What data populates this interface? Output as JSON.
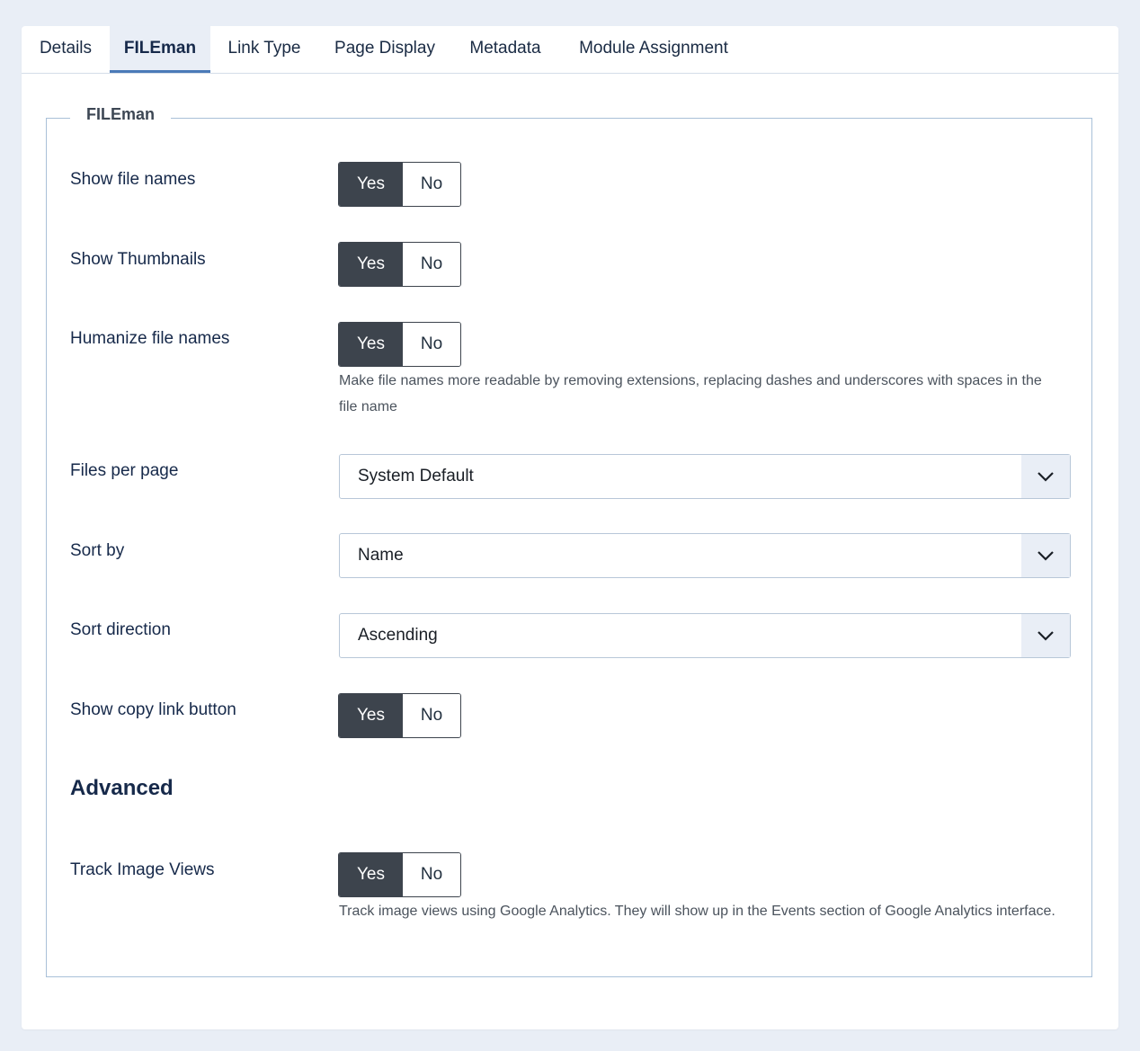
{
  "tabs": [
    {
      "label": "Details"
    },
    {
      "label": "FILEman"
    },
    {
      "label": "Link Type"
    },
    {
      "label": "Page Display"
    },
    {
      "label": "Metadata"
    },
    {
      "label": "Module Assignment"
    }
  ],
  "active_tab": "FILEman",
  "fieldset": {
    "legend": "FILEman"
  },
  "fields": {
    "show_file_names": {
      "label": "Show file names",
      "yes": "Yes",
      "no": "No",
      "value": "Yes"
    },
    "show_thumbnails": {
      "label": "Show Thumbnails",
      "yes": "Yes",
      "no": "No",
      "value": "Yes"
    },
    "humanize_file_names": {
      "label": "Humanize file names",
      "yes": "Yes",
      "no": "No",
      "value": "Yes",
      "hint": "Make file names more readable by removing extensions, replacing dashes and underscores with spaces in the file name"
    },
    "files_per_page": {
      "label": "Files per page",
      "value": "System Default"
    },
    "sort_by": {
      "label": "Sort by",
      "value": "Name"
    },
    "sort_direction": {
      "label": "Sort direction",
      "value": "Ascending"
    },
    "show_copy_link_button": {
      "label": "Show copy link button",
      "yes": "Yes",
      "no": "No",
      "value": "Yes"
    }
  },
  "advanced": {
    "heading": "Advanced",
    "track_image_views": {
      "label": "Track Image Views",
      "yes": "Yes",
      "no": "No",
      "value": "Yes",
      "hint": "Track image views using Google Analytics. They will show up in the Events section of Google Analytics interface."
    }
  },
  "colors": {
    "toggle_active": "#3d444d",
    "tab_active_bg": "#e9eef6",
    "tab_active_border": "#4a7ab8",
    "page_bg": "#e9eef6"
  }
}
